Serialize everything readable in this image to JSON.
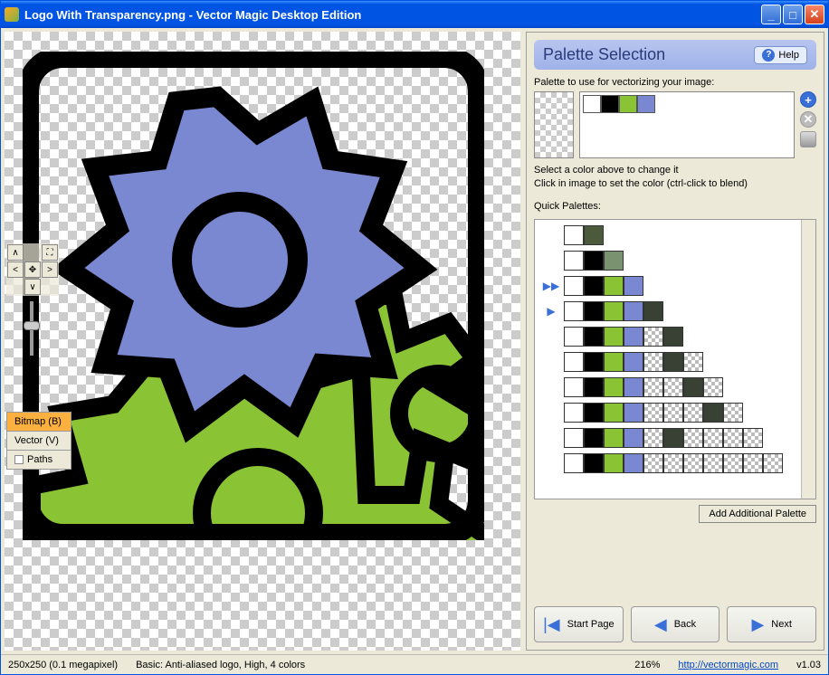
{
  "window": {
    "title": "Logo With Transparency.png - Vector Magic Desktop Edition"
  },
  "panel": {
    "title": "Palette Selection",
    "help_label": "Help",
    "palette_label": "Palette to use for vectorizing your image:",
    "hint1": "Select a color above to change it",
    "hint2": "Click in image to set the color (ctrl-click to blend)",
    "quick_label": "Quick Palettes:",
    "add_palette": "Add Additional Palette",
    "current_palette": [
      "#ffffff",
      "#000000",
      "#8ac333",
      "#7a87d1"
    ]
  },
  "quick_palettes": [
    {
      "marker": "",
      "colors": [
        "#ffffff",
        "#4b5a3d"
      ]
    },
    {
      "marker": "",
      "colors": [
        "#ffffff",
        "#000000",
        "#7a9270"
      ]
    },
    {
      "marker": "double",
      "colors": [
        "#ffffff",
        "#000000",
        "#8ac333",
        "#7a87d1"
      ]
    },
    {
      "marker": "single",
      "colors": [
        "#ffffff",
        "#000000",
        "#8ac333",
        "#7a87d1",
        "#394135"
      ]
    },
    {
      "marker": "",
      "colors": [
        "#ffffff",
        "#000000",
        "#8ac333",
        "#7a87d1",
        "checker",
        "#394135"
      ]
    },
    {
      "marker": "",
      "colors": [
        "#ffffff",
        "#000000",
        "#8ac333",
        "#7a87d1",
        "checker",
        "#394135",
        "checker"
      ]
    },
    {
      "marker": "",
      "colors": [
        "#ffffff",
        "#000000",
        "#8ac333",
        "#7a87d1",
        "checker",
        "checker",
        "#394135",
        "checker"
      ]
    },
    {
      "marker": "",
      "colors": [
        "#ffffff",
        "#000000",
        "#8ac333",
        "#7a87d1",
        "checker",
        "checker",
        "checker",
        "#394135",
        "checker"
      ]
    },
    {
      "marker": "",
      "colors": [
        "#ffffff",
        "#000000",
        "#8ac333",
        "#7a87d1",
        "checker",
        "#394135",
        "checker",
        "checker",
        "checker",
        "checker"
      ]
    },
    {
      "marker": "",
      "colors": [
        "#ffffff",
        "#000000",
        "#8ac333",
        "#7a87d1",
        "checker",
        "checker",
        "checker",
        "checker",
        "checker",
        "checker",
        "checker"
      ]
    }
  ],
  "layer_tabs": {
    "bitmap": "Bitmap (B)",
    "vector": "Vector (V)",
    "paths": "Paths"
  },
  "nav": {
    "start": "Start Page",
    "back": "Back",
    "next": "Next"
  },
  "status": {
    "dims": "250x250 (0.1 megapixel)",
    "mode": "Basic: Anti-aliased logo, High, 4 colors",
    "zoom": "216%",
    "url": "http://vectormagic.com",
    "version": "v1.03"
  }
}
